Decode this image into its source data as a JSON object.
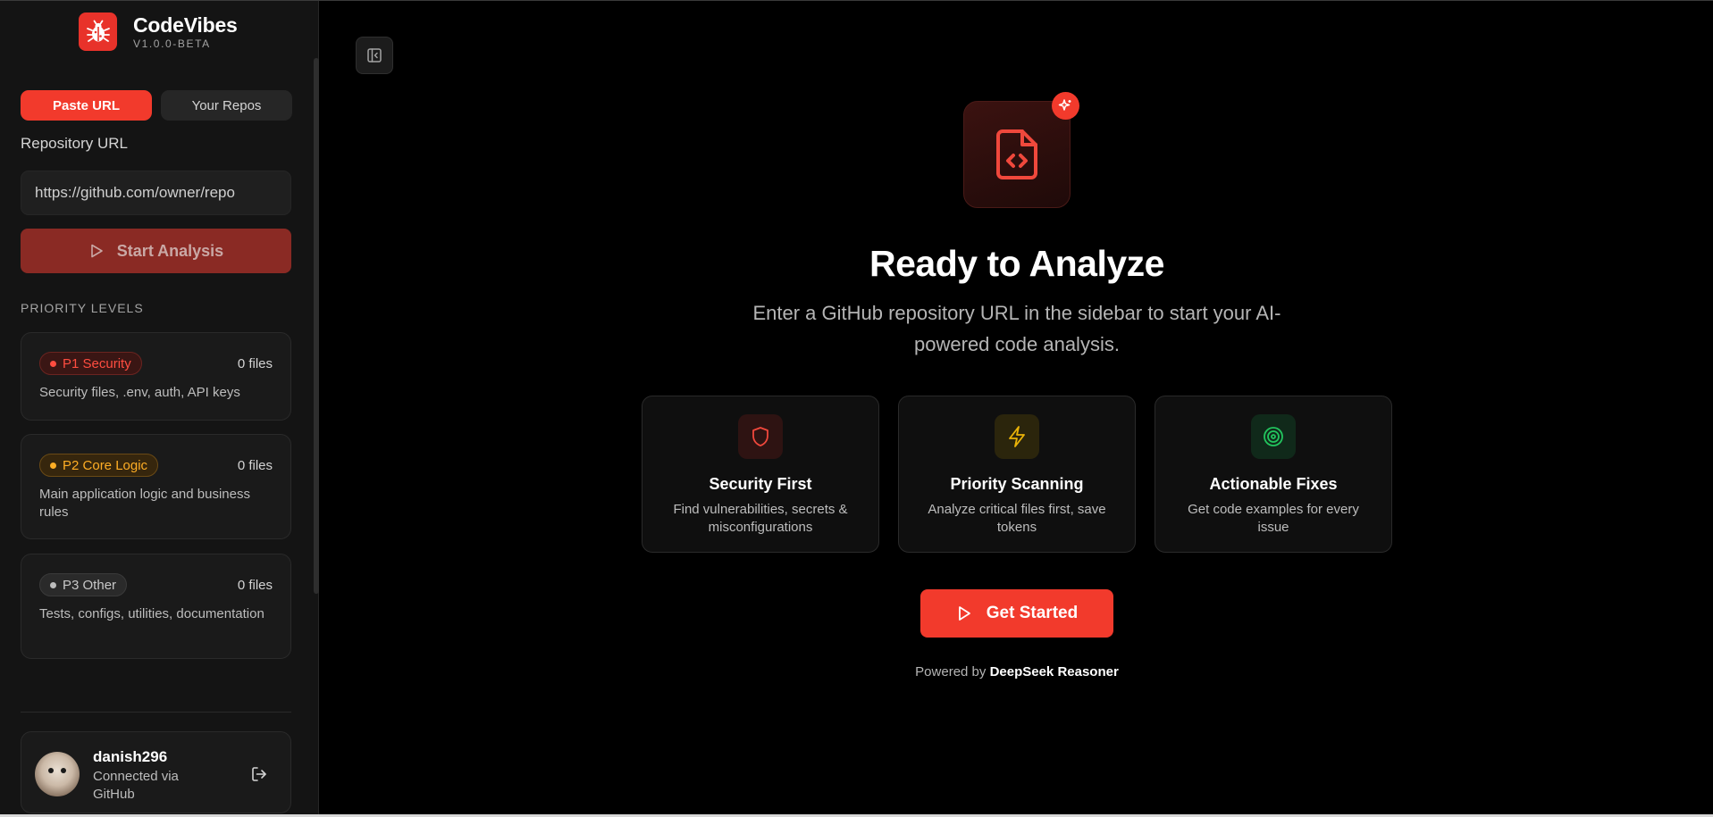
{
  "brand": {
    "name": "CodeVibes",
    "version": "V1.0.0-BETA",
    "icon": "bug-icon",
    "color": "#e8322a"
  },
  "sidebar": {
    "tabs": [
      {
        "label": "Paste URL",
        "active": true
      },
      {
        "label": "Your Repos",
        "active": false
      }
    ],
    "repo_label": "Repository URL",
    "repo_placeholder": "https://github.com/owner/repo",
    "start_button": "Start Analysis",
    "priority_title": "PRIORITY LEVELS",
    "priorities": [
      {
        "badge": "P1 Security",
        "files": "0 files",
        "desc": "Security files, .env, auth, API keys",
        "color": "#ff4d40"
      },
      {
        "badge": "P2 Core Logic",
        "files": "0 files",
        "desc": "Main application logic and business rules",
        "color": "#ffae25"
      },
      {
        "badge": "P3 Other",
        "files": "0 files",
        "desc": "Tests, configs, utilities, documentation",
        "color": "#bdbdbd"
      }
    ],
    "user": {
      "name": "danish296",
      "sub": "Connected via GitHub"
    }
  },
  "main": {
    "title": "Ready to Analyze",
    "subtitle": "Enter a GitHub repository URL in the sidebar to start your AI-powered code analysis.",
    "features": [
      {
        "title": "Security First",
        "desc": "Find vulnerabilities, secrets & misconfigurations",
        "icon": "shield-icon",
        "color": "#f0483c"
      },
      {
        "title": "Priority Scanning",
        "desc": "Analyze critical files first, save tokens",
        "icon": "lightning-icon",
        "color": "#eab308"
      },
      {
        "title": "Actionable Fixes",
        "desc": "Get code examples for every issue",
        "icon": "target-icon",
        "color": "#22c55e"
      }
    ],
    "cta": "Get Started",
    "powered_prefix": "Powered by",
    "powered_name": "DeepSeek Reasoner"
  }
}
